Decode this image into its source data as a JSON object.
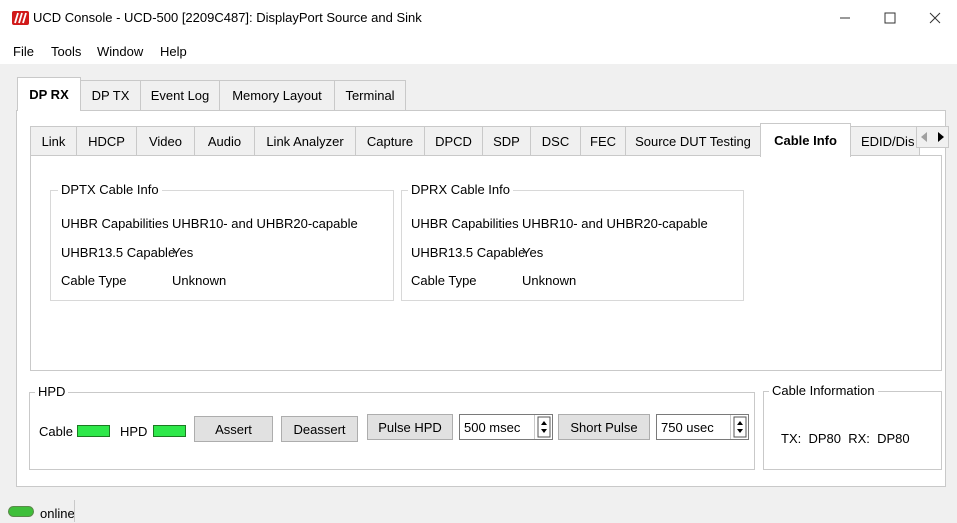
{
  "window": {
    "title": "UCD Console - UCD-500 [2209C487]: DisplayPort Source and Sink",
    "logo_color": "#d11a1a"
  },
  "menu": [
    "File",
    "Tools",
    "Window",
    "Help"
  ],
  "main_tabs": [
    "DP RX",
    "DP TX",
    "Event Log",
    "Memory Layout",
    "Terminal"
  ],
  "sub_tabs": [
    "Link",
    "HDCP",
    "Video",
    "Audio",
    "Link Analyzer",
    "Capture",
    "DPCD",
    "SDP",
    "DSC",
    "FEC",
    "Source DUT Testing",
    "Cable Info",
    "EDID/Dis"
  ],
  "dptx": {
    "title": "DPTX Cable Info",
    "uhbr_cap_label": "UHBR Capabilities",
    "uhbr_cap_value": "UHBR10- and UHBR20-capable",
    "uhbr135_label": "UHBR13.5 Capable",
    "uhbr135_value": "Yes",
    "cable_type_label": "Cable Type",
    "cable_type_value": "Unknown"
  },
  "dprx": {
    "title": "DPRX Cable Info",
    "uhbr_cap_label": "UHBR Capabilities",
    "uhbr_cap_value": "UHBR10- and UHBR20-capable",
    "uhbr135_label": "UHBR13.5 Capable",
    "uhbr135_value": "Yes",
    "cable_type_label": "Cable Type",
    "cable_type_value": "Unknown"
  },
  "hpd": {
    "title": "HPD",
    "cable_label": "Cable",
    "hpd_label": "HPD",
    "led_color": "#2ee84a",
    "assert_label": "Assert",
    "deassert_label": "Deassert",
    "pulse_label": "Pulse HPD",
    "pulse_value": "500 msec",
    "short_pulse_label": "Short Pulse",
    "short_pulse_value": "750 usec"
  },
  "cable_information": {
    "title": "Cable Information",
    "text": "TX:  DP80  RX:  DP80"
  },
  "status": {
    "text": "online",
    "color": "#3fbf3a"
  }
}
